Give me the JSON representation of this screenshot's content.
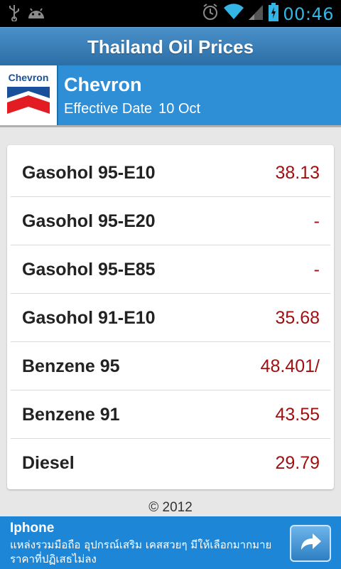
{
  "status_bar": {
    "time": "00:46",
    "icons": [
      "usb-icon",
      "android-icon",
      "alarm-icon",
      "wifi-icon",
      "signal-icon",
      "battery-charging-icon"
    ]
  },
  "app": {
    "title": "Thailand Oil Prices"
  },
  "brand": {
    "logo_text": "Chevron",
    "name": "Chevron",
    "effective_label": "Effective Date",
    "effective_date": "10 Oct"
  },
  "prices": [
    {
      "name": "Gasohol 95-E10",
      "price": "38.13"
    },
    {
      "name": "Gasohol 95-E20",
      "price": "-"
    },
    {
      "name": "Gasohol 95-E85",
      "price": "-"
    },
    {
      "name": "Gasohol 91-E10",
      "price": "35.68"
    },
    {
      "name": "Benzene 95",
      "price": "48.401/"
    },
    {
      "name": "Benzene 91",
      "price": "43.55"
    },
    {
      "name": "Diesel",
      "price": "29.79"
    }
  ],
  "footer": {
    "copyright": "© 2012"
  },
  "ad": {
    "title": "Iphone",
    "description": "แหล่งรวมมือถือ อุปกรณ์เสริม เคสสวยๆ มีให้เลือกมากมาย ราคาที่ปฏิเสธไม่ลง"
  },
  "colors": {
    "accent": "#33b5e5",
    "title_bar": "#2c6ea6",
    "brand_bar": "#2f8fd6",
    "price": "#a01010",
    "ad_bg": "#1e86d6"
  }
}
